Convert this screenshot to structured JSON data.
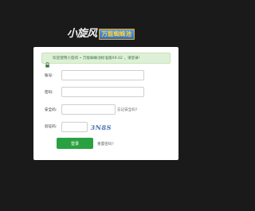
{
  "header": {
    "logo_text": "小旋风",
    "logo_tag": "万能蜘蛛池"
  },
  "alert": {
    "icon": "lock-icon",
    "text": "欢迎使用小旋风 • 万能蜘蛛池标准版X9.02 ，请登录!"
  },
  "form": {
    "account_label": "账号:",
    "account_value": "",
    "password_label": "密码:",
    "password_value": "",
    "security_label": "安全码:",
    "security_value": "",
    "forgot_security_link": "忘记安全码?",
    "captcha_label": "验证码:",
    "captcha_value": "",
    "captcha_image_text": "3N8S",
    "login_button": "登录",
    "reset_password_link": "重置密码?"
  },
  "colors": {
    "background": "#1a1a1a",
    "card": "#ffffff",
    "alert_bg": "#dff0d8",
    "alert_text": "#3c763d",
    "primary_button": "#2aa141"
  }
}
